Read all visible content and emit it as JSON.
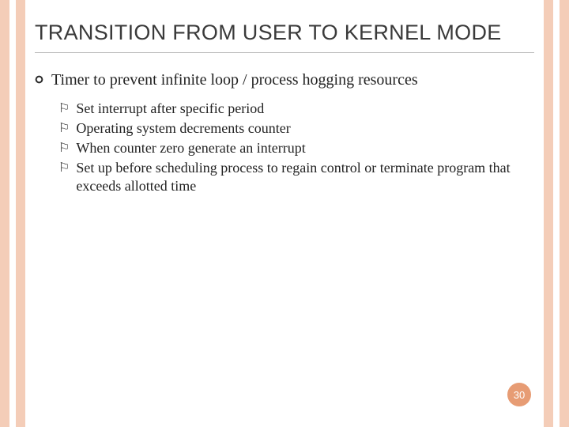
{
  "title": "TRANSITION FROM USER TO KERNEL MODE",
  "main_item": "Timer to prevent infinite loop / process hogging resources",
  "sub_items": [
    "Set interrupt after specific period",
    "Operating system decrements counter",
    "When counter zero generate an interrupt",
    "Set up before scheduling process to regain control or terminate program that exceeds allotted time"
  ],
  "page_number": "30",
  "colors": {
    "accent_stripe": "#f4cdb8",
    "page_badge": "#e79c74"
  }
}
